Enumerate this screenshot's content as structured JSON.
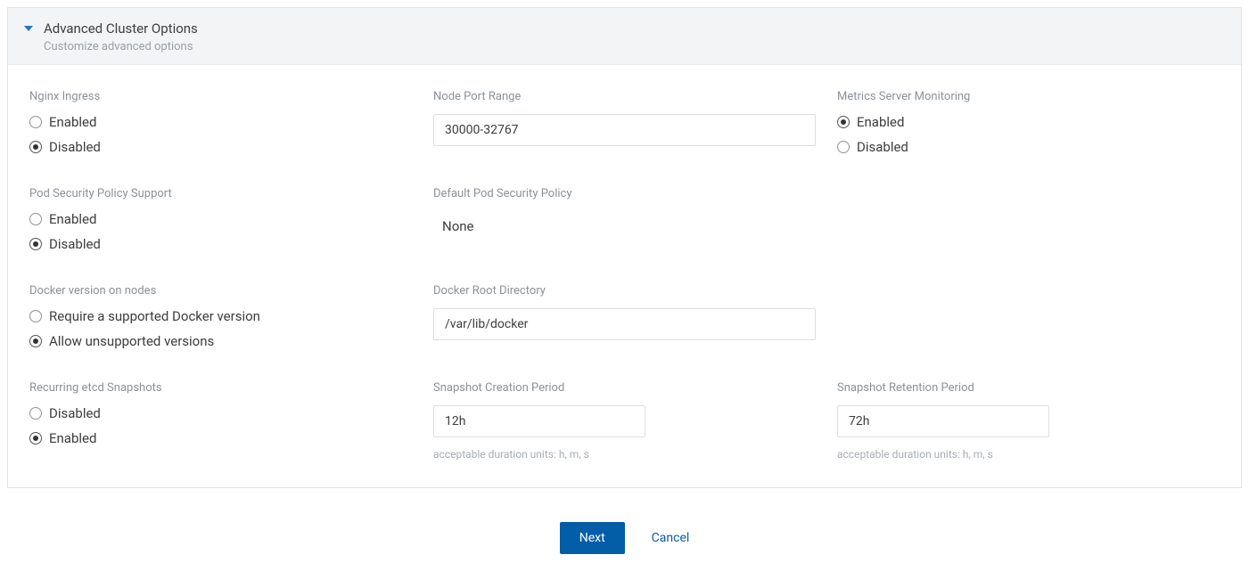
{
  "panel": {
    "title": "Advanced Cluster Options",
    "subtitle": "Customize advanced options"
  },
  "form": {
    "nginx_ingress": {
      "label": "Nginx Ingress",
      "options": {
        "enabled": "Enabled",
        "disabled": "Disabled"
      },
      "selected": "disabled"
    },
    "node_port_range": {
      "label": "Node Port Range",
      "value": "30000-32767"
    },
    "metrics_server": {
      "label": "Metrics Server Monitoring",
      "options": {
        "enabled": "Enabled",
        "disabled": "Disabled"
      },
      "selected": "enabled"
    },
    "pod_security": {
      "label": "Pod Security Policy Support",
      "options": {
        "enabled": "Enabled",
        "disabled": "Disabled"
      },
      "selected": "disabled"
    },
    "default_pod_policy": {
      "label": "Default Pod Security Policy",
      "value": "None"
    },
    "docker_version": {
      "label": "Docker version on nodes",
      "options": {
        "require": "Require a supported Docker version",
        "allow": "Allow unsupported versions"
      },
      "selected": "allow"
    },
    "docker_root": {
      "label": "Docker Root Directory",
      "value": "/var/lib/docker"
    },
    "etcd_snapshots": {
      "label": "Recurring etcd Snapshots",
      "options": {
        "disabled": "Disabled",
        "enabled": "Enabled"
      },
      "selected": "enabled"
    },
    "snapshot_creation": {
      "label": "Snapshot Creation Period",
      "value": "12h",
      "hint": "acceptable duration units: h, m, s"
    },
    "snapshot_retention": {
      "label": "Snapshot Retention Period",
      "value": "72h",
      "hint": "acceptable duration units: h, m, s"
    }
  },
  "footer": {
    "next": "Next",
    "cancel": "Cancel"
  }
}
